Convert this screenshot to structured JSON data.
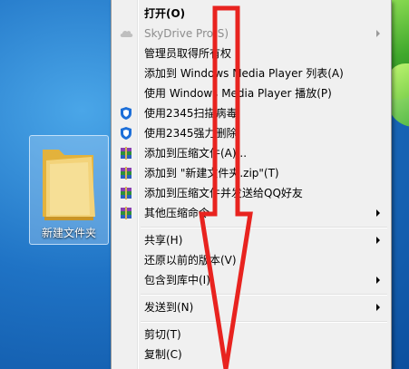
{
  "desktop": {
    "folder": {
      "label": "新建文件夹"
    }
  },
  "menu": {
    "items": [
      {
        "label": "打开(O)"
      },
      {
        "label": "SkyDrive Pro(S)"
      },
      {
        "label": "管理员取得所有权"
      },
      {
        "label": "添加到 Windows Media Player 列表(A)"
      },
      {
        "label": "使用 Windows Media Player 播放(P)"
      },
      {
        "label": "使用2345扫描病毒"
      },
      {
        "label": "使用2345强力删除"
      },
      {
        "label": "添加到压缩文件(A)..."
      },
      {
        "label": "添加到 \"新建文件夹.zip\"(T)"
      },
      {
        "label": "添加到压缩文件并发送给QQ好友"
      },
      {
        "label": "其他压缩命令"
      },
      {
        "label": "共享(H)"
      },
      {
        "label": "还原以前的版本(V)"
      },
      {
        "label": "包含到库中(I)"
      },
      {
        "label": "发送到(N)"
      },
      {
        "label": "剪切(T)"
      },
      {
        "label": "复制(C)"
      }
    ]
  },
  "colors": {
    "annotation_red": "#e8231f",
    "menu_bg": "#f0f0f0",
    "shield_blue": "#1d6fd8"
  }
}
